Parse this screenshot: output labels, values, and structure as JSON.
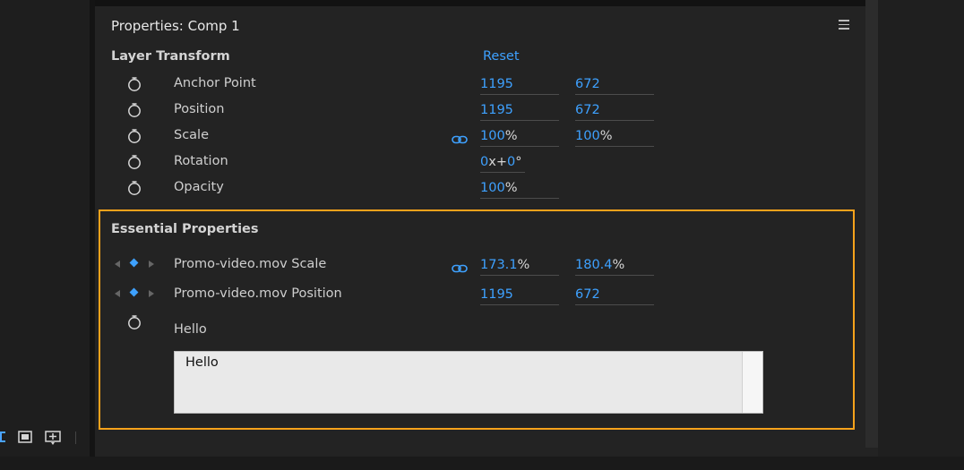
{
  "panel": {
    "title": "Properties: Comp 1"
  },
  "layer_transform": {
    "title": "Layer Transform",
    "reset_label": "Reset",
    "rows": [
      {
        "label": "Anchor Point",
        "x": "1195",
        "y": "672"
      },
      {
        "label": "Position",
        "x": "1195",
        "y": "672"
      },
      {
        "label": "Scale",
        "x": "100",
        "x_unit": "%",
        "y": "100",
        "y_unit": "%"
      },
      {
        "label": "Rotation",
        "rot_turns": "0",
        "rot_sep": "x+",
        "rot_deg": "0",
        "rot_unit": "°"
      },
      {
        "label": "Opacity",
        "value": "100",
        "unit": "%"
      }
    ]
  },
  "essential_properties": {
    "title": "Essential Properties",
    "rows": [
      {
        "label": "Promo-video.mov Scale",
        "x": "173.1",
        "x_unit": "%",
        "y": "180.4",
        "y_unit": "%"
      },
      {
        "label": "Promo-video.mov Position",
        "x": "1195",
        "y": "672"
      }
    ],
    "text_property": {
      "label": "Hello",
      "value": "Hello"
    }
  },
  "colors": {
    "accent": "#3ea1ff",
    "highlight_border": "#f7a21b"
  }
}
